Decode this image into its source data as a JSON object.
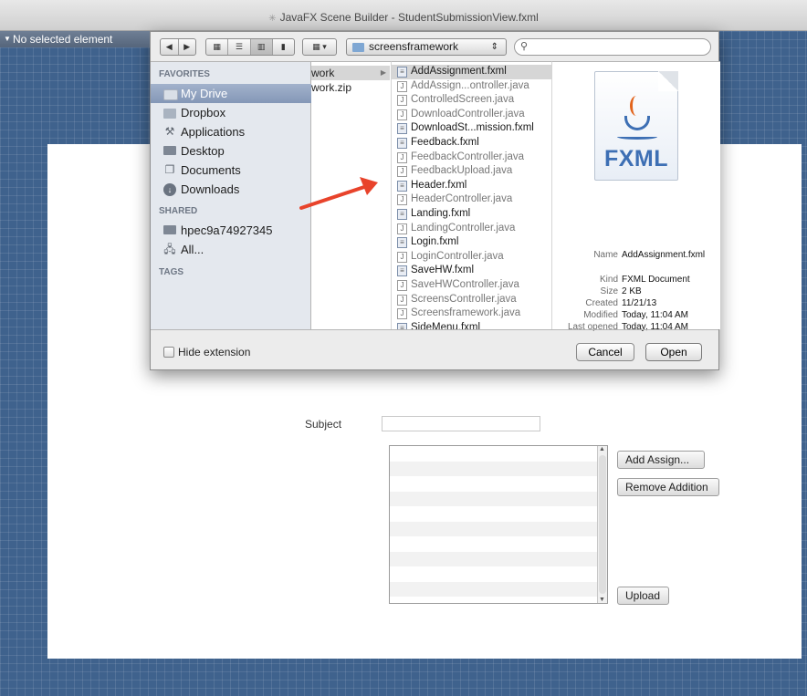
{
  "window": {
    "title_icon": "javafx-logo-icon",
    "title": "JavaFX Scene Builder - StudentSubmissionView.fxml"
  },
  "inspector": {
    "label": "No selected element"
  },
  "form": {
    "subject_label": "Subject",
    "buttons": {
      "add": "Add Assign...",
      "remove": "Remove Addition",
      "upload": "Upload"
    },
    "list_row_count": 10
  },
  "dialog": {
    "location": "screensframework",
    "search_placeholder": "",
    "sidebar": {
      "favorites_header": "FAVORITES",
      "favorites": [
        {
          "label": "My Drive",
          "icon": "drive-icon",
          "selected": true
        },
        {
          "label": "Dropbox",
          "icon": "folder-icon",
          "selected": false
        },
        {
          "label": "Applications",
          "icon": "applications-icon",
          "selected": false
        },
        {
          "label": "Desktop",
          "icon": "desktop-icon",
          "selected": false
        },
        {
          "label": "Documents",
          "icon": "documents-icon",
          "selected": false
        },
        {
          "label": "Downloads",
          "icon": "downloads-icon",
          "selected": false
        }
      ],
      "shared_header": "SHARED",
      "shared": [
        {
          "label": "hpec9a74927345",
          "icon": "computer-icon"
        },
        {
          "label": "All...",
          "icon": "network-icon"
        }
      ],
      "tags_header": "TAGS"
    },
    "column1": [
      "work",
      "work.zip"
    ],
    "files": [
      {
        "name": "AddAssignment.fxml",
        "type": "fxml",
        "selected": true
      },
      {
        "name": "AddAssign...ontroller.java",
        "type": "java"
      },
      {
        "name": "ControlledScreen.java",
        "type": "java"
      },
      {
        "name": "DownloadController.java",
        "type": "java"
      },
      {
        "name": "DownloadSt...mission.fxml",
        "type": "fxml"
      },
      {
        "name": "Feedback.fxml",
        "type": "fxml"
      },
      {
        "name": "FeedbackController.java",
        "type": "java"
      },
      {
        "name": "FeedbackUpload.java",
        "type": "java"
      },
      {
        "name": "Header.fxml",
        "type": "fxml"
      },
      {
        "name": "HeaderController.java",
        "type": "java"
      },
      {
        "name": "Landing.fxml",
        "type": "fxml"
      },
      {
        "name": "LandingController.java",
        "type": "java"
      },
      {
        "name": "Login.fxml",
        "type": "fxml"
      },
      {
        "name": "LoginController.java",
        "type": "java"
      },
      {
        "name": "SaveHW.fxml",
        "type": "fxml"
      },
      {
        "name": "SaveHWController.java",
        "type": "java"
      },
      {
        "name": "ScreensController.java",
        "type": "java"
      },
      {
        "name": "Screensframework.java",
        "type": "java"
      },
      {
        "name": "SideMenu.fxml",
        "type": "fxml"
      }
    ],
    "preview": {
      "icon_label": "FXML",
      "meta": [
        {
          "key": "Name",
          "value": "AddAssignment.fxml"
        },
        {
          "key": "Kind",
          "value": "FXML Document"
        },
        {
          "key": "Size",
          "value": "2 KB"
        },
        {
          "key": "Created",
          "value": "11/21/13"
        },
        {
          "key": "Modified",
          "value": "Today, 11:04 AM"
        },
        {
          "key": "Last opened",
          "value": "Today, 11:04 AM"
        }
      ]
    },
    "hide_extension_label": "Hide extension",
    "hide_extension_checked": false,
    "cancel_label": "Cancel",
    "open_label": "Open"
  },
  "colors": {
    "canvas": "#3f628d",
    "annotation_arrow": "#e8432b",
    "sidebar_selected": "#8497b7"
  }
}
